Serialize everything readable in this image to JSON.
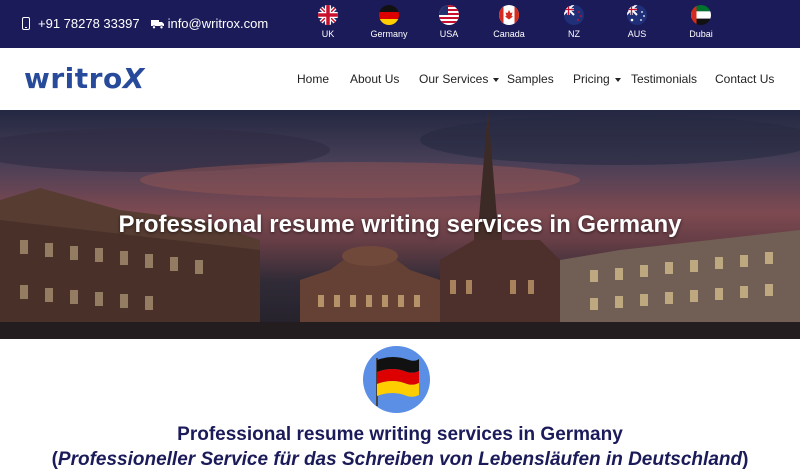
{
  "topbar": {
    "phone": "+91 78278 33397",
    "email": "info@writrox.com",
    "flags": [
      {
        "label": "UK",
        "icon": "uk-flag-icon"
      },
      {
        "label": "Germany",
        "icon": "germany-flag-icon"
      },
      {
        "label": "USA",
        "icon": "usa-flag-icon"
      },
      {
        "label": "Canada",
        "icon": "canada-flag-icon"
      },
      {
        "label": "NZ",
        "icon": "nz-flag-icon"
      },
      {
        "label": "AUS",
        "icon": "australia-flag-icon"
      },
      {
        "label": "Dubai",
        "icon": "uae-flag-icon"
      }
    ]
  },
  "nav": {
    "logo_main": "writro",
    "logo_x": "X",
    "items": [
      {
        "label": "Home"
      },
      {
        "label": "About Us"
      },
      {
        "label": "Our Services"
      },
      {
        "label": "Samples"
      },
      {
        "label": "Pricing"
      },
      {
        "label": "Testimonials"
      },
      {
        "label": "Contact Us"
      }
    ]
  },
  "hero": {
    "title": "Professional resume writing services in Germany"
  },
  "content": {
    "title": "Professional resume writing services in Germany",
    "subtitle_open": "(",
    "subtitle_italic": "Professioneller Service für das Schreiben von Lebensläufen in Deutschland",
    "subtitle_close": ")"
  },
  "colors": {
    "topbar_bg": "#1c1b5a",
    "logo": "#274b9a",
    "heading": "#1c1b5a",
    "badge": "#5b8fe6"
  }
}
